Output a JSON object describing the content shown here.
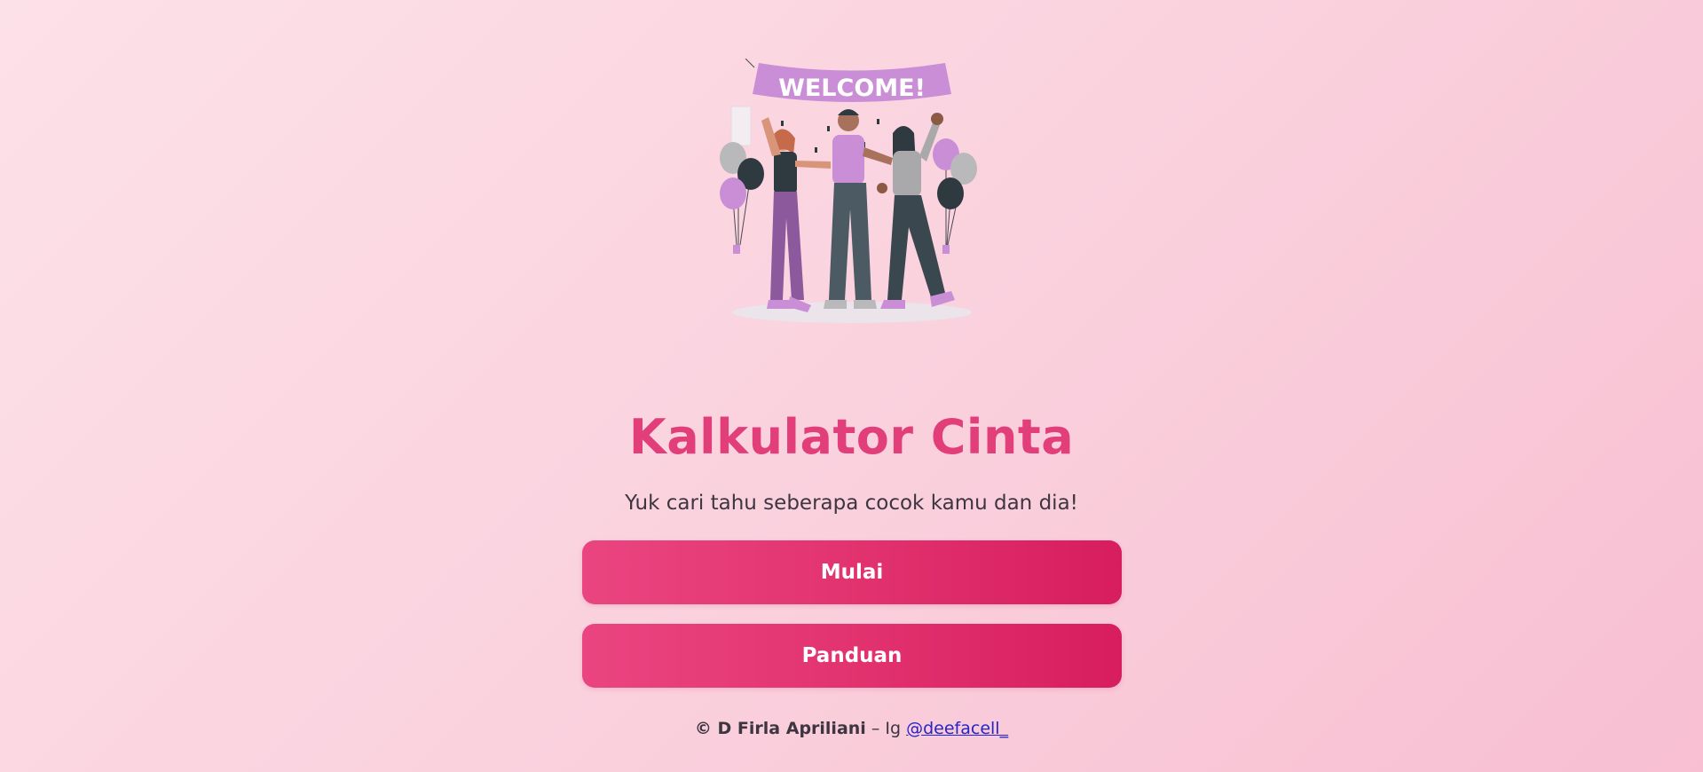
{
  "hero": {
    "banner_text": "WELCOME!",
    "illustration": "welcome-party-illustration"
  },
  "title": "Kalkulator Cinta",
  "subtitle": "Yuk cari tahu seberapa cocok kamu dan dia!",
  "buttons": {
    "start_label": "Mulai",
    "guide_label": "Panduan"
  },
  "footer": {
    "copyright": "© D Firla Apriliani",
    "separator": " – Ig ",
    "handle": "@deefacell_"
  },
  "colors": {
    "accent": "#e13e7a",
    "button_start": "#ea4580",
    "button_end": "#d71d5e",
    "background_light": "#fde1e8",
    "background_dark": "#f8bfd2",
    "link": "#2424c8"
  }
}
